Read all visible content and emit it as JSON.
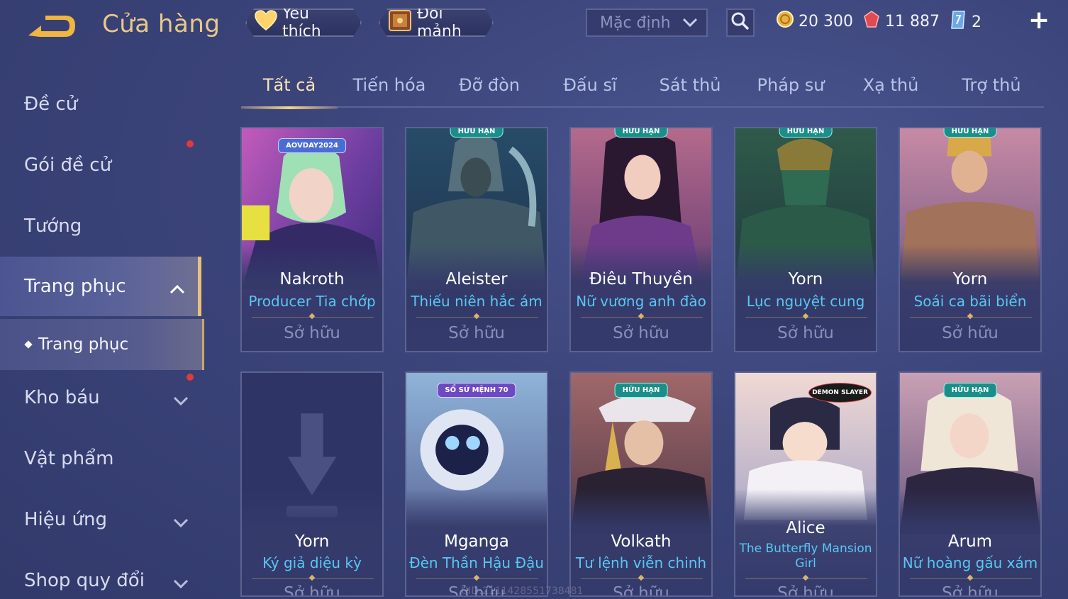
{
  "header": {
    "title": "Cửa hàng",
    "favorite_label": "Yêu thích",
    "shard_label": "Đổi mảnh",
    "sort_value": "Mặc định",
    "gold": "20 300",
    "ruby": "11 887",
    "tickets": "2",
    "plus": "+"
  },
  "sidebar": {
    "items": [
      {
        "label": "Đề cử"
      },
      {
        "label": "Gói đề cử"
      },
      {
        "label": "Tướng"
      },
      {
        "label": "Trang phục"
      },
      {
        "label": "Kho báu"
      },
      {
        "label": "Vật phẩm"
      },
      {
        "label": "Hiệu ứng"
      },
      {
        "label": "Shop quy đổi"
      }
    ],
    "sub_item": "Trang phục"
  },
  "tabs": [
    "Tất cả",
    "Tiến hóa",
    "Đỡ đòn",
    "Đấu sĩ",
    "Sát thủ",
    "Pháp sư",
    "Xạ thủ",
    "Trợ thủ"
  ],
  "cards": [
    {
      "hero": "Nakroth",
      "skin": "Producer Tia chớp",
      "status": "Sở hữu",
      "badge": "AOVDAY2024"
    },
    {
      "hero": "Aleister",
      "skin": "Thiếu niên hắc ám",
      "status": "Sở hữu",
      "badge": "HỮU HẠN"
    },
    {
      "hero": "Điêu Thuyền",
      "skin": "Nữ vương anh đào",
      "status": "Sở hữu",
      "badge": "HỮU HẠN"
    },
    {
      "hero": "Yorn",
      "skin": "Lục nguyệt cung",
      "status": "Sở hữu",
      "badge": "HỮU HẠN"
    },
    {
      "hero": "Yorn",
      "skin": "Soái ca bãi biển",
      "status": "Sở hữu",
      "badge": "HỮU HẠN"
    },
    {
      "hero": "Yorn",
      "skin": "Ký giả diệu kỳ",
      "status": "Sở hữu",
      "badge": ""
    },
    {
      "hero": "Mganga",
      "skin": "Đèn Thần Hậu Đậu",
      "status": "Sở hữu",
      "badge": "SỔ SỨ MỆNH 70"
    },
    {
      "hero": "Volkath",
      "skin": "Tư lệnh viễn chinh",
      "status": "Sở hữu",
      "badge": "HỮU HẠN"
    },
    {
      "hero": "Alice",
      "skin": "The Butterfly Mansion Girl",
      "status": "Sở hữu",
      "badge": "DEMON SLAYER"
    },
    {
      "hero": "Arum",
      "skin": "Nữ hoàng gấu xám",
      "status": "Sở hữu",
      "badge": "HỮU HẠN"
    }
  ],
  "watermark": "UID:2111428551738481",
  "colors": {
    "accent_gold": "#e8c98a",
    "skin_name": "#59c6f2",
    "badge_teal": "#1a8f8a",
    "notify_red": "#e4393b"
  }
}
